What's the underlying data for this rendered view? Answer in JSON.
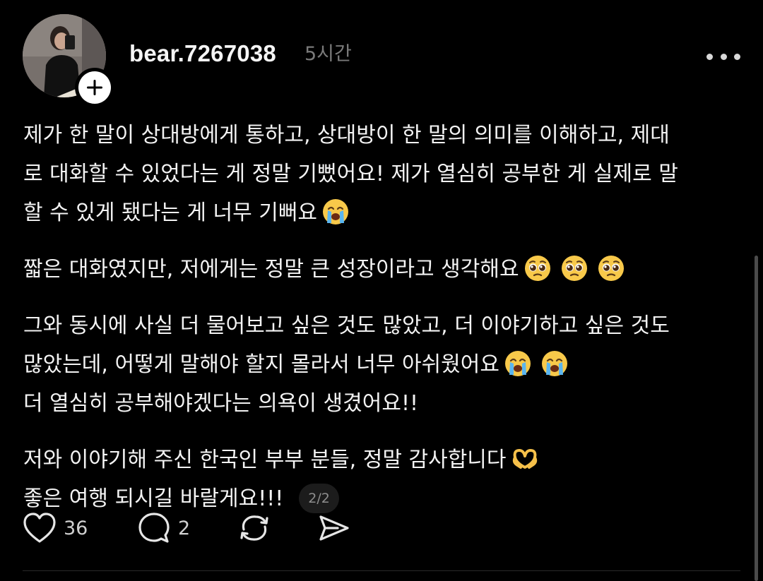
{
  "post": {
    "username": "bear.7267038",
    "timestamp": "5시간",
    "avatar_icon": "profile-photo",
    "follow_icon": "plus-icon",
    "more_icon": "more-horizontal-icon"
  },
  "body": {
    "p1": {
      "line1": "제가 한 말이 상대방에게 통하고, 상대방이 한 말의 의미를 이해하고, 제대",
      "line2": "로 대화할 수 있었다는 게 정말 기뻤어요! 제가 열심히 공부한 게 실제로 말",
      "line3": "할 수 있게 됐다는 게 너무 기뻐요"
    },
    "p2": {
      "line1": "짧은 대화였지만, 저에게는 정말 큰 성장이라고 생각해요"
    },
    "p3": {
      "line1": "그와 동시에 사실 더 물어보고 싶은 것도 많았고, 더 이야기하고 싶은 것도",
      "line2": "많았는데, 어떻게 말해야 할지 몰라서 너무 아쉬웠어요",
      "line3": "더 열심히 공부해야겠다는 의욕이 생겼어요!!"
    },
    "p4": {
      "line1": "저와 이야기해 주신 한국인 부부 분들, 정말 감사합니다",
      "line2": "좋은 여행 되시길 바랄게요!!!"
    },
    "page_indicator": "2/2",
    "emoji_names": [
      "loudly-crying-face",
      "pleading-face",
      "heart-hands"
    ]
  },
  "actions": {
    "like_count": "36",
    "reply_count": "2",
    "icons": [
      "heart-icon",
      "comment-icon",
      "repost-icon",
      "share-icon"
    ]
  }
}
